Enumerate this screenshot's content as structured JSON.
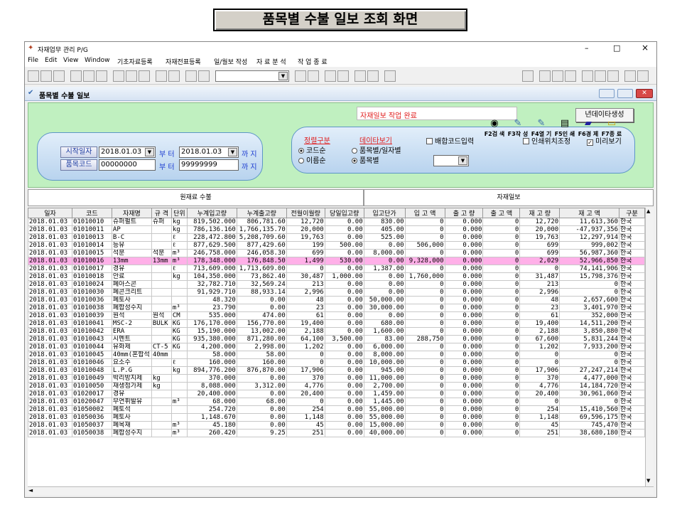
{
  "banner": "품목별 수불 일보 조회 화면",
  "window": {
    "title": "자재업무 관리 P/G",
    "minimize": "–",
    "maximize": "□",
    "close": "×"
  },
  "menu": [
    "File",
    "Edit",
    "View",
    "Window",
    "기초자료등록",
    "자재전표등록",
    "일/월보 작성",
    "자 료 분 석",
    "작 업 종 료"
  ],
  "child": {
    "title": "품목별 수불 일보"
  },
  "form": {
    "status": "자재일보 작업 완료",
    "gen_button": "년데이타생성",
    "start_date_label": "시작일자",
    "start_date": "2018.01.03",
    "from": "부 터",
    "end_date": "2018.01.03",
    "to": "까 지",
    "item_code_label": "품목코드",
    "item_code_from": "00000000",
    "item_code_to": "99999999",
    "sort_label": "정렬구분",
    "sort_options": [
      "코드순",
      "이름순"
    ],
    "view_label": "데이타보기",
    "view_options": [
      "품목별/일자별",
      "품목별"
    ],
    "mix_code": "배합코드입력",
    "print_adjust": "인쇄위치조정",
    "preview": "미리보기",
    "fkeys": [
      "F2검 색",
      "F3작 성",
      "F4열 기",
      "F5인 쇄",
      "F6경 제",
      "F7종 료"
    ]
  },
  "sections": {
    "left": "원재료 수불",
    "right": "자재일보"
  },
  "columns": [
    "일자",
    "코드",
    "자재명",
    "규 격",
    "단위",
    "누계입고량",
    "누계출고량",
    "전월이월량",
    "당일입고량",
    "입고단가",
    "입 고 액",
    "출 고 량",
    "출 고 액",
    "재 고 량",
    "재 고 액",
    "구분"
  ],
  "rows": [
    [
      "2018.01.03",
      "01010010",
      "슈퍼펄트",
      "슈퍼",
      "kg",
      "819,502.000",
      "806,781.60",
      "12,720",
      "0.00",
      "830.00",
      "0",
      "0.000",
      "0",
      "12,720",
      "11,613,360",
      "한국"
    ],
    [
      "2018.01.03",
      "01010011",
      "AP",
      "",
      "kg",
      "786,136.160",
      "1,766,135.70",
      "20,000",
      "0.00",
      "405.00",
      "0",
      "0.000",
      "0",
      "20,000",
      "-47,937,356",
      "한국"
    ],
    [
      "2018.01.03",
      "01010013",
      "B-C",
      "",
      "ℓ",
      "228,472.800",
      "5,208,709.60",
      "19,763",
      "0.00",
      "525.00",
      "0",
      "0.000",
      "0",
      "19,763",
      "12,297,914",
      "한국"
    ],
    [
      "2018.01.03",
      "01010014",
      "등유",
      "",
      "ℓ",
      "877,629.500",
      "877,429.60",
      "199",
      "500.00",
      "0.00",
      "506,000",
      "0.000",
      "0",
      "699",
      "999,002",
      "한국"
    ],
    [
      "2018.01.03",
      "01010015",
      "석분",
      "석분",
      "m³",
      "246,758.000",
      "246,058.30",
      "699",
      "0.00",
      "8,000.00",
      "0",
      "0.000",
      "0",
      "699",
      "56,987,360",
      "한국"
    ],
    [
      "2018.01.03",
      "01010016",
      "13mm",
      "13mm",
      "m³",
      "178,348.000",
      "176,848.50",
      "1,499",
      "530.00",
      "0.00",
      "9,328,000",
      "0.000",
      "0",
      "2,029",
      "52,966,850",
      "한국"
    ],
    [
      "2018.01.03",
      "01010017",
      "경유",
      "",
      "ℓ",
      "713,609.000",
      "1,713,609.00",
      "0",
      "0.00",
      "1,387.00",
      "0",
      "0.000",
      "0",
      "0",
      "74,141,906",
      "한국"
    ],
    [
      "2018.01.03",
      "01010018",
      "안료",
      "",
      "kg",
      "104,350.000",
      "73,862.40",
      "30,487",
      "1,000.00",
      "0.00",
      "1,760,000",
      "0.000",
      "0",
      "31,487",
      "15,798,376",
      "한국"
    ],
    [
      "2018.01.03",
      "01010024",
      "폐아스콘",
      "",
      "",
      "32,782.710",
      "32,569.24",
      "213",
      "0.00",
      "0.00",
      "0",
      "0.000",
      "0",
      "213",
      "0",
      "한국"
    ],
    [
      "2018.01.03",
      "01010030",
      "폐콘크리트",
      "",
      "",
      "91,929.710",
      "88,933.14",
      "2,996",
      "0.00",
      "0.00",
      "0",
      "0.000",
      "0",
      "2,996",
      "0",
      "한국"
    ],
    [
      "2018.01.03",
      "01010036",
      "폐토사",
      "",
      "",
      "48.320",
      "0.00",
      "48",
      "0.00",
      "50,000.00",
      "0",
      "0.000",
      "0",
      "48",
      "2,657,600",
      "한국"
    ],
    [
      "2018.01.03",
      "01010038",
      "폐합성수지",
      "",
      "m³",
      "23.790",
      "0.00",
      "23",
      "0.00",
      "30,000.00",
      "0",
      "0.000",
      "0",
      "23",
      "3,401,970",
      "한국"
    ],
    [
      "2018.01.03",
      "01010039",
      "원석",
      "원석",
      "CM",
      "535.000",
      "474.00",
      "61",
      "0.00",
      "0.00",
      "0",
      "0.000",
      "0",
      "61",
      "352,000",
      "한국"
    ],
    [
      "2018.01.03",
      "01010041",
      "MSC-2",
      "BULK",
      "KG",
      "176,170.000",
      "156,770.00",
      "19,400",
      "0.00",
      "680.00",
      "0",
      "0.000",
      "0",
      "19,400",
      "14,511,200",
      "한국"
    ],
    [
      "2018.01.03",
      "01010042",
      "ERA",
      "",
      "KG",
      "15,190.000",
      "13,002.00",
      "2,188",
      "0.00",
      "1,600.00",
      "0",
      "0.000",
      "0",
      "2,188",
      "3,850,880",
      "한국"
    ],
    [
      "2018.01.03",
      "01010043",
      "시멘트",
      "",
      "KG",
      "935,380.000",
      "871,280.00",
      "64,100",
      "3,500.00",
      "83.00",
      "288,750",
      "0.000",
      "0",
      "67,600",
      "5,831,244",
      "한국"
    ],
    [
      "2018.01.03",
      "01010044",
      "유화제",
      "CT-5",
      "KG",
      "4,200.000",
      "2,998.00",
      "1,202",
      "0.00",
      "6,000.00",
      "0",
      "0.000",
      "0",
      "1,202",
      "7,933,200",
      "한국"
    ],
    [
      "2018.01.03",
      "01010045",
      "40mm(혼합석",
      "40mm",
      "",
      "58.000",
      "58.00",
      "0",
      "0.00",
      "8,000.00",
      "0",
      "0.000",
      "0",
      "0",
      "0",
      "한국"
    ],
    [
      "2018.01.03",
      "01010046",
      "요소수",
      "",
      "ℓ",
      "160.000",
      "160.00",
      "0",
      "0.00",
      "10,000.00",
      "0",
      "0.000",
      "0",
      "0",
      "0",
      "한국"
    ],
    [
      "2018.01.03",
      "01010048",
      "L.P.G",
      "",
      "kg",
      "894,776.200",
      "876,870.00",
      "17,906",
      "0.00",
      "945.00",
      "0",
      "0.000",
      "0",
      "17,906",
      "27,247,214",
      "한국"
    ],
    [
      "2018.01.03",
      "01010049",
      "박리방지제",
      "kg",
      "",
      "370.000",
      "0.00",
      "370",
      "0.00",
      "11,000.00",
      "0",
      "0.000",
      "0",
      "370",
      "4,477,000",
      "한국"
    ],
    [
      "2018.01.03",
      "01010050",
      "재생첨가제",
      "kg",
      "",
      "8,088.000",
      "3,312.00",
      "4,776",
      "0.00",
      "2,700.00",
      "0",
      "0.000",
      "0",
      "4,776",
      "14,184,720",
      "한국"
    ],
    [
      "2018.01.03",
      "01020017",
      "경유",
      "",
      "",
      "20,400.000",
      "0.00",
      "20,400",
      "0.00",
      "1,459.00",
      "0",
      "0.000",
      "0",
      "20,400",
      "30,961,060",
      "한국"
    ],
    [
      "2018.01.03",
      "01020047",
      "무연휘발유",
      "",
      "m³",
      "68.000",
      "68.00",
      "0",
      "0.00",
      "1,445.00",
      "0",
      "0.000",
      "0",
      "0",
      "0",
      "한국"
    ],
    [
      "2018.01.03",
      "01050002",
      "폐토석",
      "",
      "",
      "254.720",
      "0.00",
      "254",
      "0.00",
      "55,000.00",
      "0",
      "0.000",
      "0",
      "254",
      "15,410,560",
      "한국"
    ],
    [
      "2018.01.03",
      "01050036",
      "폐토사",
      "",
      "",
      "1,148.670",
      "0.00",
      "1,148",
      "0.00",
      "55,000.00",
      "0",
      "0.000",
      "0",
      "1,148",
      "69,596,175",
      "한국"
    ],
    [
      "2018.01.03",
      "01050037",
      "폐목재",
      "",
      "m³",
      "45.180",
      "0.00",
      "45",
      "0.00",
      "15,000.00",
      "0",
      "0.000",
      "0",
      "45",
      "745,470",
      "한국"
    ],
    [
      "2018.01.03",
      "01050038",
      "폐합성수지",
      "",
      "m³",
      "260.420",
      "9.25",
      "251",
      "0.00",
      "40,000.00",
      "0",
      "0.000",
      "0",
      "251",
      "38,680,180",
      "한국"
    ]
  ],
  "selected_row": 5,
  "colors": {
    "form_bg": "#c0f0c0",
    "pill_bg": "#c8dcf0",
    "selected_row": "#ffb0e8",
    "label_blue": "#1a3ad0",
    "label_red": "#e02020"
  }
}
